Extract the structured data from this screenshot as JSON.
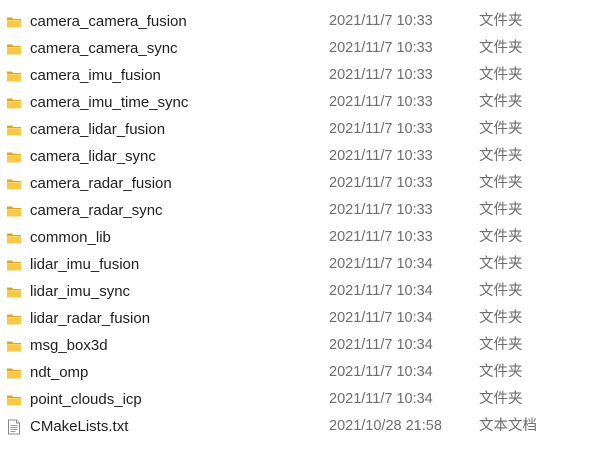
{
  "files": [
    {
      "name": "camera_camera_fusion",
      "date": "2021/11/7 10:33",
      "type": "文件夹",
      "icon": "folder-icon"
    },
    {
      "name": "camera_camera_sync",
      "date": "2021/11/7 10:33",
      "type": "文件夹",
      "icon": "folder-icon"
    },
    {
      "name": "camera_imu_fusion",
      "date": "2021/11/7 10:33",
      "type": "文件夹",
      "icon": "folder-icon"
    },
    {
      "name": "camera_imu_time_sync",
      "date": "2021/11/7 10:33",
      "type": "文件夹",
      "icon": "folder-icon"
    },
    {
      "name": "camera_lidar_fusion",
      "date": "2021/11/7 10:33",
      "type": "文件夹",
      "icon": "folder-icon"
    },
    {
      "name": "camera_lidar_sync",
      "date": "2021/11/7 10:33",
      "type": "文件夹",
      "icon": "folder-icon"
    },
    {
      "name": "camera_radar_fusion",
      "date": "2021/11/7 10:33",
      "type": "文件夹",
      "icon": "folder-icon"
    },
    {
      "name": "camera_radar_sync",
      "date": "2021/11/7 10:33",
      "type": "文件夹",
      "icon": "folder-icon"
    },
    {
      "name": "common_lib",
      "date": "2021/11/7 10:33",
      "type": "文件夹",
      "icon": "folder-icon"
    },
    {
      "name": "lidar_imu_fusion",
      "date": "2021/11/7 10:34",
      "type": "文件夹",
      "icon": "folder-icon"
    },
    {
      "name": "lidar_imu_sync",
      "date": "2021/11/7 10:34",
      "type": "文件夹",
      "icon": "folder-icon"
    },
    {
      "name": "lidar_radar_fusion",
      "date": "2021/11/7 10:34",
      "type": "文件夹",
      "icon": "folder-icon"
    },
    {
      "name": "msg_box3d",
      "date": "2021/11/7 10:34",
      "type": "文件夹",
      "icon": "folder-icon"
    },
    {
      "name": "ndt_omp",
      "date": "2021/11/7 10:34",
      "type": "文件夹",
      "icon": "folder-icon"
    },
    {
      "name": "point_clouds_icp",
      "date": "2021/11/7 10:34",
      "type": "文件夹",
      "icon": "folder-icon"
    },
    {
      "name": "CMakeLists.txt",
      "date": "2021/10/28 21:58",
      "type": "文本文档",
      "icon": "text-file-icon"
    }
  ],
  "colors": {
    "folder_body": "#f7c948",
    "folder_back": "#e0a51c",
    "folder_tab": "#d99a12",
    "name_text": "#1f1f1f",
    "meta_text": "#6d6d6d"
  }
}
